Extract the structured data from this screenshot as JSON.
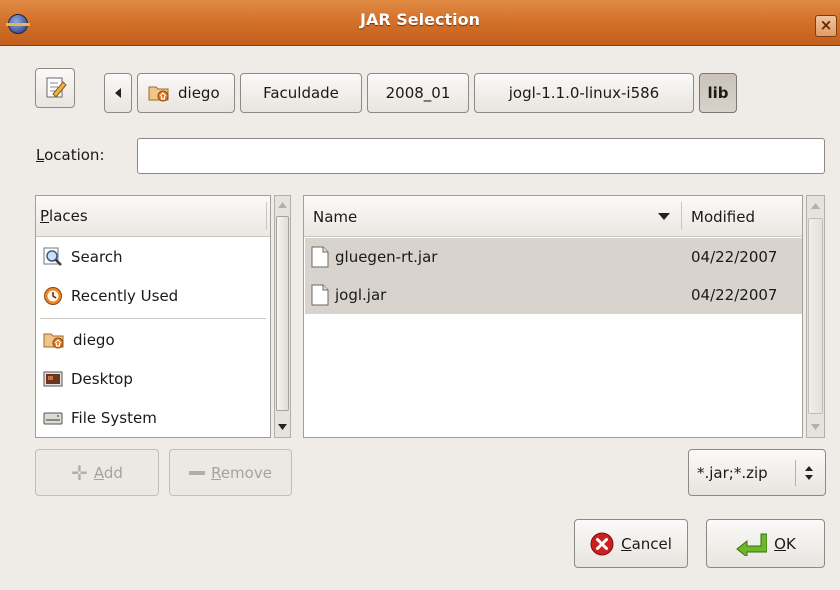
{
  "window": {
    "title": "JAR Selection",
    "close_glyph": "×"
  },
  "path_bar": {
    "segments": [
      "diego",
      "Faculdade",
      "2008_01",
      "jogl-1.1.0-linux-i586",
      "lib"
    ],
    "active": "lib"
  },
  "location": {
    "label_prefix": "L",
    "label_rest": "ocation:",
    "value": ""
  },
  "places": {
    "header_prefix": "P",
    "header_rest": "laces",
    "items": [
      {
        "label": "Search",
        "icon": "search-icon"
      },
      {
        "label": "Recently Used",
        "icon": "recent-icon"
      },
      {
        "label": "diego",
        "icon": "home-folder-icon"
      },
      {
        "label": "Desktop",
        "icon": "desktop-icon"
      },
      {
        "label": "File System",
        "icon": "drive-icon"
      }
    ],
    "add_prefix": "A",
    "add_rest": "dd",
    "remove_prefix": "R",
    "remove_rest": "emove"
  },
  "files": {
    "col_name": "Name",
    "col_modified": "Modified",
    "rows": [
      {
        "name": "gluegen-rt.jar",
        "modified": "04/22/2007"
      },
      {
        "name": "jogl.jar",
        "modified": "04/22/2007"
      }
    ]
  },
  "filter": {
    "value": "*.jar;*.zip"
  },
  "buttons": {
    "cancel_prefix": "C",
    "cancel_rest": "ancel",
    "ok_prefix": "O",
    "ok_rest": "K"
  },
  "colors": {
    "titlebar": "#d2702a",
    "selection": "#d8d3cd",
    "background": "#efebe7"
  }
}
